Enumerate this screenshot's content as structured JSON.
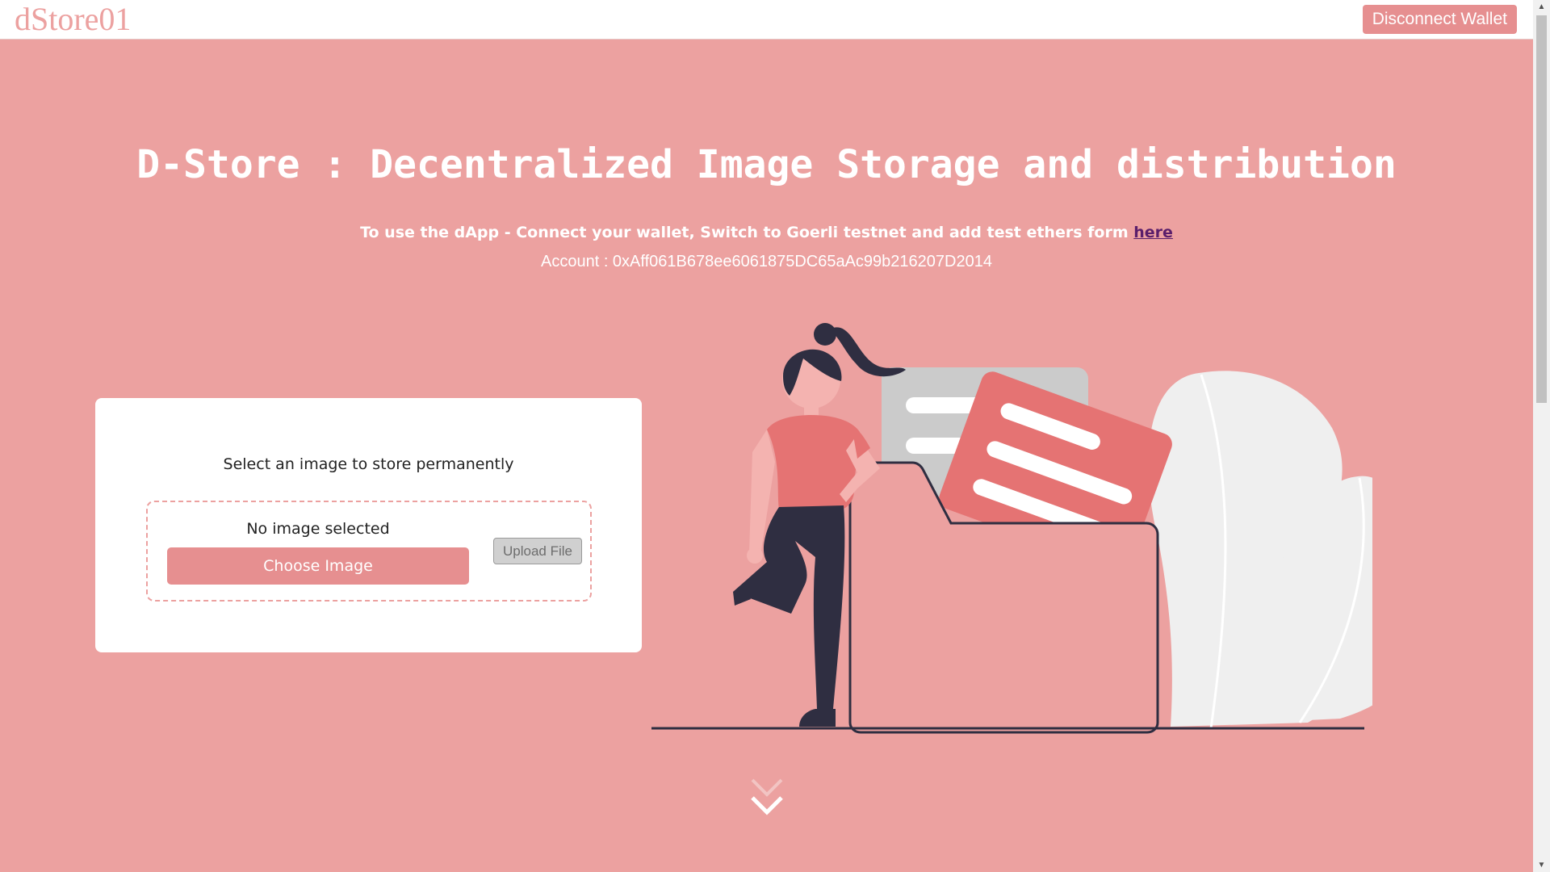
{
  "navbar": {
    "brand": "dStore01",
    "disconnect_label": "Disconnect Wallet"
  },
  "hero": {
    "title": "D-Store : Decentralized Image Storage and distribution",
    "instruction": "To use the dApp - Connect your wallet, Switch to Goerli testnet and add test ethers form",
    "link_text": "here",
    "account": "Account : 0xAff061B678ee6061875DC65aAc99b216207D2014"
  },
  "upload": {
    "heading": "Select an image to store permanently",
    "file_status": "No image selected",
    "choose_label": "Choose Image",
    "upload_label": "Upload File"
  },
  "icons": {
    "scroll_hint": "chevron-double-down-icon",
    "illustration": "woman-with-folder-illustration"
  },
  "colors": {
    "accent": "#eca1a0",
    "button": "#e68f90",
    "link": "#5a1e6b",
    "illustration_red": "#e57373",
    "illustration_dark": "#2f2e41"
  }
}
